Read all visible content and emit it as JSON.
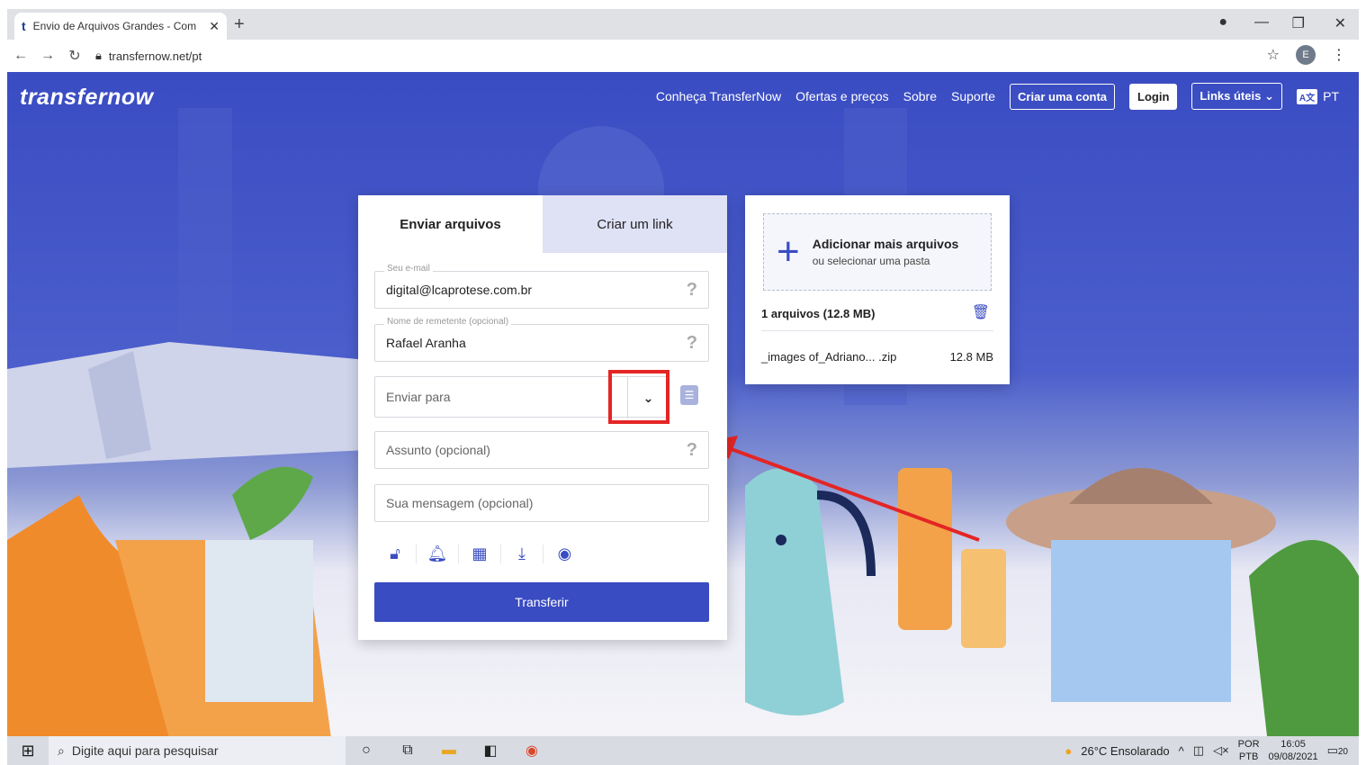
{
  "browser": {
    "tab_title": "Envio de Arquivos Grandes - Com",
    "tab_favicon": "t",
    "url": "transfernow.net/pt"
  },
  "header": {
    "logo": "transfernow",
    "nav": [
      "Conheça TransferNow",
      "Ofertas e preços",
      "Sobre",
      "Suporte"
    ],
    "create_account": "Criar uma conta",
    "login": "Login",
    "useful_links": "Links úteis",
    "lang_badge": "A文",
    "lang": "PT"
  },
  "form": {
    "tabs": [
      "Enviar arquivos",
      "Criar um link"
    ],
    "email_label": "Seu e-mail",
    "email_value": "digital@lcaprotese.com.br",
    "sender_label": "Nome de remetente (opcional)",
    "sender_value": "Rafael Aranha",
    "send_to_placeholder": "Enviar para",
    "subject_placeholder": "Assunto (opcional)",
    "message_placeholder": "Sua mensagem (opcional)",
    "help": "?",
    "transfer_button": "Transferir"
  },
  "files": {
    "add_title": "Adicionar mais arquivos",
    "add_subtitle": "ou selecionar uma pasta",
    "count": "1 arquivos (12.8 MB)",
    "file_name": "_images of_Adriano... .zip",
    "file_size": "12.8 MB"
  },
  "taskbar": {
    "search_placeholder": "Digite aqui para pesquisar",
    "weather": "26°C  Ensolarado",
    "lang_top": "POR",
    "lang_bottom": "PTB",
    "time": "16:05",
    "date": "09/08/2021",
    "notif_count": "20"
  },
  "colors": {
    "brand_blue": "#3a4cc2",
    "highlight_red": "#e42525"
  }
}
